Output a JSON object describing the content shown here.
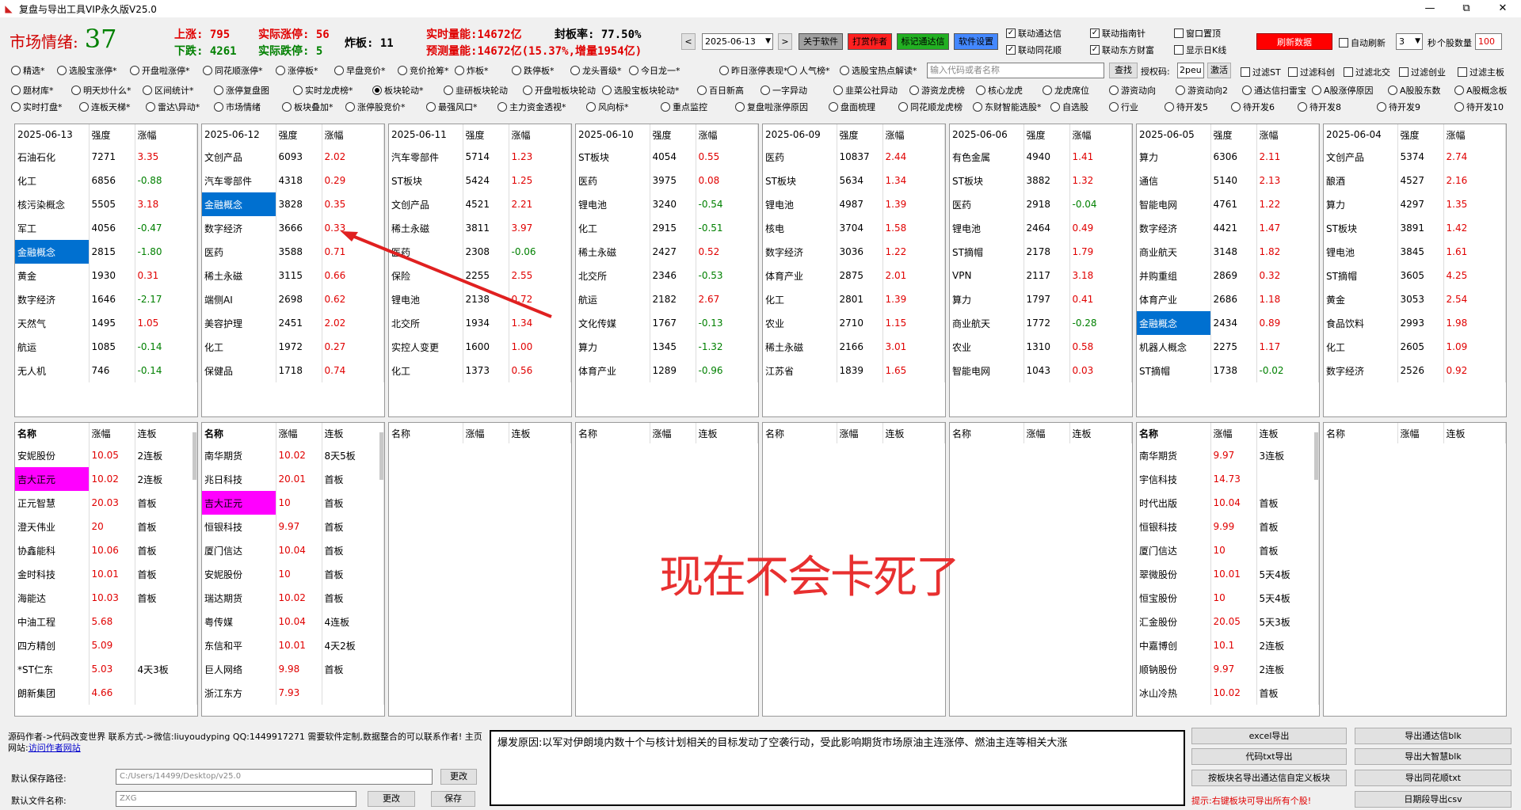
{
  "window": {
    "title": "复盘与导出工具VIP永久版V25.0",
    "minimize": "—",
    "maximize": "⧉",
    "close": "✕"
  },
  "sentiment": {
    "label": "市场情绪:",
    "value": "37"
  },
  "stats": {
    "up_label": "上涨:",
    "up": "795",
    "down_label": "下跌:",
    "down": "4261",
    "real_limit_up_label": "实际涨停:",
    "real_limit_up": "56",
    "real_limit_down_label": "实际跌停:",
    "real_limit_down": "5",
    "broken_label": "炸板:",
    "broken": "11",
    "realtime_volume_label": "实时量能:",
    "realtime_volume": "14672亿",
    "seal_rate_label": "封板率:",
    "seal_rate": "77.50%",
    "forecast_volume_label": "预测量能:",
    "forecast_volume": "14672亿(15.37%,增量1954亿)"
  },
  "toolbar": {
    "date": "2025-06-13",
    "prev": "<",
    "next": ">",
    "about": "关于软件",
    "reward": "打赏作者",
    "mark_tdx": "标记通达信",
    "settings": "软件设置",
    "refresh": "刷新数据",
    "auto_refresh": "自动刷新",
    "interval": "3",
    "sec_label": "秒",
    "stock_count_label": "个股数量",
    "stock_count": "100",
    "checks": {
      "link_tdx": "联动通达信",
      "link_zhinan": "联动指南针",
      "window_top": "窗口置顶",
      "link_ths": "联动同花顺",
      "link_dfcf": "联动东方财富",
      "show_daily_k": "显示日K线"
    }
  },
  "radio_rows": [
    [
      "精选*",
      "选股宝涨停*",
      "开盘啦涨停*",
      "同花顺涨停*",
      "涨停板*",
      "早盘竞价*",
      "竞价抢筹*",
      "炸板*",
      "跌停板*",
      "龙头晋级*",
      "今日龙一*",
      "昨日涨停表现*",
      "人气榜*",
      "选股宝热点解读*"
    ],
    [
      "题材库*",
      "明天炒什么*",
      "区间统计*",
      "涨停复盘图",
      "实时龙虎榜*",
      "板块轮动*",
      "韭研板块轮动",
      "开盘啦板块轮动",
      "选股宝板块轮动*",
      "百日新高",
      "一字异动",
      "韭菜公社异动",
      "游资龙虎榜",
      "核心龙虎",
      "龙虎席位",
      "游资动向",
      "游资动向2",
      "通达信扫雷宝",
      "A股涨停原因",
      "A股股东数",
      "A股概念板"
    ],
    [
      "实时打盘*",
      "连板天梯*",
      "雷达\\异动*",
      "市场情绪",
      "板块叠加*",
      "涨停股竞价*",
      "最强风口*",
      "主力资金透视*",
      "风向标*",
      "重点监控",
      "复盘啦涨停原因",
      "盘面梳理",
      "同花顺龙虎榜",
      "东财智能选股*",
      "自选股",
      "行业",
      "待开发5",
      "待开发6",
      "待开发8",
      "待开发9",
      "待开发10"
    ]
  ],
  "search": {
    "placeholder": "输入代码或者名称",
    "button": "查找",
    "auth_label": "授权码:",
    "auth_code": "2peu",
    "activate": "激活"
  },
  "filters": [
    "过滤ST",
    "过滤科创",
    "过滤北交",
    "过滤创业",
    "过滤主板"
  ],
  "top_panels": [
    {
      "date": "2025-06-13",
      "h2": "强度",
      "h3": "涨幅",
      "rows": [
        [
          "石油石化",
          "7271",
          "3.35"
        ],
        [
          "化工",
          "6856",
          "-0.88"
        ],
        [
          "核污染概念",
          "5505",
          "3.18"
        ],
        [
          "军工",
          "4056",
          "-0.47"
        ],
        [
          "金融概念",
          "2815",
          "-1.80"
        ],
        [
          "黄金",
          "1930",
          "0.31"
        ],
        [
          "数字经济",
          "1646",
          "-2.17"
        ],
        [
          "天然气",
          "1495",
          "1.05"
        ],
        [
          "航运",
          "1085",
          "-0.14"
        ],
        [
          "无人机",
          "746",
          "-0.14"
        ]
      ]
    },
    {
      "date": "2025-06-12",
      "h2": "强度",
      "h3": "涨幅",
      "rows": [
        [
          "文创产品",
          "6093",
          "2.02"
        ],
        [
          "汽车零部件",
          "4318",
          "0.29"
        ],
        [
          "金融概念",
          "3828",
          "0.35"
        ],
        [
          "数字经济",
          "3666",
          "0.33"
        ],
        [
          "医药",
          "3588",
          "0.71"
        ],
        [
          "稀土永磁",
          "3115",
          "0.66"
        ],
        [
          "端侧AI",
          "2698",
          "0.62"
        ],
        [
          "美容护理",
          "2451",
          "2.02"
        ],
        [
          "化工",
          "1972",
          "0.27"
        ],
        [
          "保健品",
          "1718",
          "0.74"
        ]
      ]
    },
    {
      "date": "2025-06-11",
      "h2": "强度",
      "h3": "涨幅",
      "rows": [
        [
          "汽车零部件",
          "5714",
          "1.23"
        ],
        [
          "ST板块",
          "5424",
          "1.25"
        ],
        [
          "文创产品",
          "4521",
          "2.21"
        ],
        [
          "稀土永磁",
          "3811",
          "3.97"
        ],
        [
          "医药",
          "2308",
          "-0.06"
        ],
        [
          "保险",
          "2255",
          "2.55"
        ],
        [
          "锂电池",
          "2138",
          "0.72"
        ],
        [
          "北交所",
          "1934",
          "1.34"
        ],
        [
          "实控人变更",
          "1600",
          "1.00"
        ],
        [
          "化工",
          "1373",
          "0.56"
        ]
      ]
    },
    {
      "date": "2025-06-10",
      "h2": "强度",
      "h3": "涨幅",
      "rows": [
        [
          "ST板块",
          "4054",
          "0.55"
        ],
        [
          "医药",
          "3975",
          "0.08"
        ],
        [
          "锂电池",
          "3240",
          "-0.54"
        ],
        [
          "化工",
          "2915",
          "-0.51"
        ],
        [
          "稀土永磁",
          "2427",
          "0.52"
        ],
        [
          "北交所",
          "2346",
          "-0.53"
        ],
        [
          "航运",
          "2182",
          "2.67"
        ],
        [
          "文化传媒",
          "1767",
          "-0.13"
        ],
        [
          "算力",
          "1345",
          "-1.32"
        ],
        [
          "体育产业",
          "1289",
          "-0.96"
        ]
      ]
    },
    {
      "date": "2025-06-09",
      "h2": "强度",
      "h3": "涨幅",
      "rows": [
        [
          "医药",
          "10837",
          "2.44"
        ],
        [
          "ST板块",
          "5634",
          "1.34"
        ],
        [
          "锂电池",
          "4987",
          "1.39"
        ],
        [
          "核电",
          "3704",
          "1.58"
        ],
        [
          "数字经济",
          "3036",
          "1.22"
        ],
        [
          "体育产业",
          "2875",
          "2.01"
        ],
        [
          "化工",
          "2801",
          "1.39"
        ],
        [
          "农业",
          "2710",
          "1.15"
        ],
        [
          "稀土永磁",
          "2166",
          "3.01"
        ],
        [
          "江苏省",
          "1839",
          "1.65"
        ]
      ]
    },
    {
      "date": "2025-06-06",
      "h2": "强度",
      "h3": "涨幅",
      "rows": [
        [
          "有色金属",
          "4940",
          "1.41"
        ],
        [
          "ST板块",
          "3882",
          "1.32"
        ],
        [
          "医药",
          "2918",
          "-0.04"
        ],
        [
          "锂电池",
          "2464",
          "0.49"
        ],
        [
          "ST摘帽",
          "2178",
          "1.79"
        ],
        [
          "VPN",
          "2117",
          "3.18"
        ],
        [
          "算力",
          "1797",
          "0.41"
        ],
        [
          "商业航天",
          "1772",
          "-0.28"
        ],
        [
          "农业",
          "1310",
          "0.58"
        ],
        [
          "智能电网",
          "1043",
          "0.03"
        ]
      ]
    },
    {
      "date": "2025-06-05",
      "h2": "强度",
      "h3": "涨幅",
      "rows": [
        [
          "算力",
          "6306",
          "2.11"
        ],
        [
          "通信",
          "5140",
          "2.13"
        ],
        [
          "智能电网",
          "4761",
          "1.22"
        ],
        [
          "数字经济",
          "4421",
          "1.47"
        ],
        [
          "商业航天",
          "3148",
          "1.82"
        ],
        [
          "并购重组",
          "2869",
          "0.32"
        ],
        [
          "体育产业",
          "2686",
          "1.18"
        ],
        [
          "金融概念",
          "2434",
          "0.89"
        ],
        [
          "机器人概念",
          "2275",
          "1.17"
        ],
        [
          "ST摘帽",
          "1738",
          "-0.02"
        ]
      ]
    },
    {
      "date": "2025-06-04",
      "h2": "强度",
      "h3": "涨幅",
      "rows": [
        [
          "文创产品",
          "5374",
          "2.74"
        ],
        [
          "酿酒",
          "4527",
          "2.16"
        ],
        [
          "算力",
          "4297",
          "1.35"
        ],
        [
          "ST板块",
          "3891",
          "1.42"
        ],
        [
          "锂电池",
          "3845",
          "1.61"
        ],
        [
          "ST摘帽",
          "3605",
          "4.25"
        ],
        [
          "黄金",
          "3053",
          "2.54"
        ],
        [
          "食品饮料",
          "2993",
          "1.98"
        ],
        [
          "化工",
          "2605",
          "1.09"
        ],
        [
          "数字经济",
          "2526",
          "0.92"
        ]
      ]
    }
  ],
  "bottom_panels": [
    {
      "h1": "名称",
      "h2": "涨幅",
      "h3": "连板",
      "rows": [
        [
          "安妮股份",
          "10.05",
          "2连板"
        ],
        [
          "吉大正元",
          "10.02",
          "2连板"
        ],
        [
          "正元智慧",
          "20.03",
          "首板"
        ],
        [
          "澄天伟业",
          "20",
          "首板"
        ],
        [
          "协鑫能科",
          "10.06",
          "首板"
        ],
        [
          "金时科技",
          "10.01",
          "首板"
        ],
        [
          "海能达",
          "10.03",
          "首板"
        ],
        [
          "中油工程",
          "5.68",
          ""
        ],
        [
          "四方精创",
          "5.09",
          ""
        ],
        [
          "*ST仁东",
          "5.03",
          "4天3板"
        ],
        [
          "朗新集团",
          "4.66",
          ""
        ]
      ]
    },
    {
      "h1": "名称",
      "h2": "涨幅",
      "h3": "连板",
      "rows": [
        [
          "南华期货",
          "10.02",
          "8天5板"
        ],
        [
          "兆日科技",
          "20.01",
          "首板"
        ],
        [
          "吉大正元",
          "10",
          "首板"
        ],
        [
          "恒银科技",
          "9.97",
          "首板"
        ],
        [
          "厦门信达",
          "10.04",
          "首板"
        ],
        [
          "安妮股份",
          "10",
          "首板"
        ],
        [
          "瑞达期货",
          "10.02",
          "首板"
        ],
        [
          "粤传媒",
          "10.04",
          "4连板"
        ],
        [
          "东信和平",
          "10.01",
          "4天2板"
        ],
        [
          "巨人网络",
          "9.98",
          "首板"
        ],
        [
          "浙江东方",
          "7.93",
          ""
        ]
      ]
    },
    {
      "h1": "名称",
      "h2": "涨幅",
      "h3": "连板",
      "rows": []
    },
    {
      "h1": "名称",
      "h2": "涨幅",
      "h3": "连板",
      "rows": []
    },
    {
      "h1": "名称",
      "h2": "涨幅",
      "h3": "连板",
      "rows": []
    },
    {
      "h1": "名称",
      "h2": "涨幅",
      "h3": "连板",
      "rows": []
    },
    {
      "h1": "名称",
      "h2": "涨幅",
      "h3": "连板",
      "rows": [
        [
          "南华期货",
          "9.97",
          "3连板"
        ],
        [
          "宇信科技",
          "14.73",
          ""
        ],
        [
          "时代出版",
          "10.04",
          "首板"
        ],
        [
          "恒银科技",
          "9.99",
          "首板"
        ],
        [
          "厦门信达",
          "10",
          "首板"
        ],
        [
          "翠微股份",
          "10.01",
          "5天4板"
        ],
        [
          "恒宝股份",
          "10",
          "5天4板"
        ],
        [
          "汇金股份",
          "20.05",
          "5天3板"
        ],
        [
          "中嘉博创",
          "10.1",
          "2连板"
        ],
        [
          "顺钠股份",
          "9.97",
          "2连板"
        ],
        [
          "冰山冷热",
          "10.02",
          "首板"
        ]
      ]
    },
    {
      "h1": "名称",
      "h2": "涨幅",
      "h3": "连板",
      "rows": []
    }
  ],
  "annotation": "现在不会卡死了",
  "footer": {
    "author_text": "源码作者->代码改变世界 联系方式->微信:liuyoudyping QQ:1449917271 需要软件定制,数据整合的可以联系作者! 主页网站:",
    "author_link": "访问作者网站",
    "save_path_label": "默认保存路径:",
    "save_path": "C:/Users/14499/Desktop/v25.0",
    "change1": "更改",
    "file_name_label": "默认文件名称:",
    "file_name": "ZXG",
    "change2": "更改",
    "save": "保存"
  },
  "reason": "爆发原因:以军对伊朗境内数十个与核计划相关的目标发动了空袭行动，受此影响期货市场原油主连涨停、燃油主连等相关大涨",
  "export": {
    "excel": "excel导出",
    "tdx_blk": "导出通达信blk",
    "code_txt": "代码txt导出",
    "dzh_blk": "导出大智慧blk",
    "by_block": "按板块名导出通达信自定义板块",
    "ths_txt": "导出同花顺txt",
    "tip": "提示:右键板块可导出所有个股!",
    "csv": "日期段导出csv"
  },
  "colors": {
    "up": "#e00000",
    "down": "#008000",
    "highlight_blue": "#0070d0",
    "highlight_magenta": "#ff00ff"
  }
}
